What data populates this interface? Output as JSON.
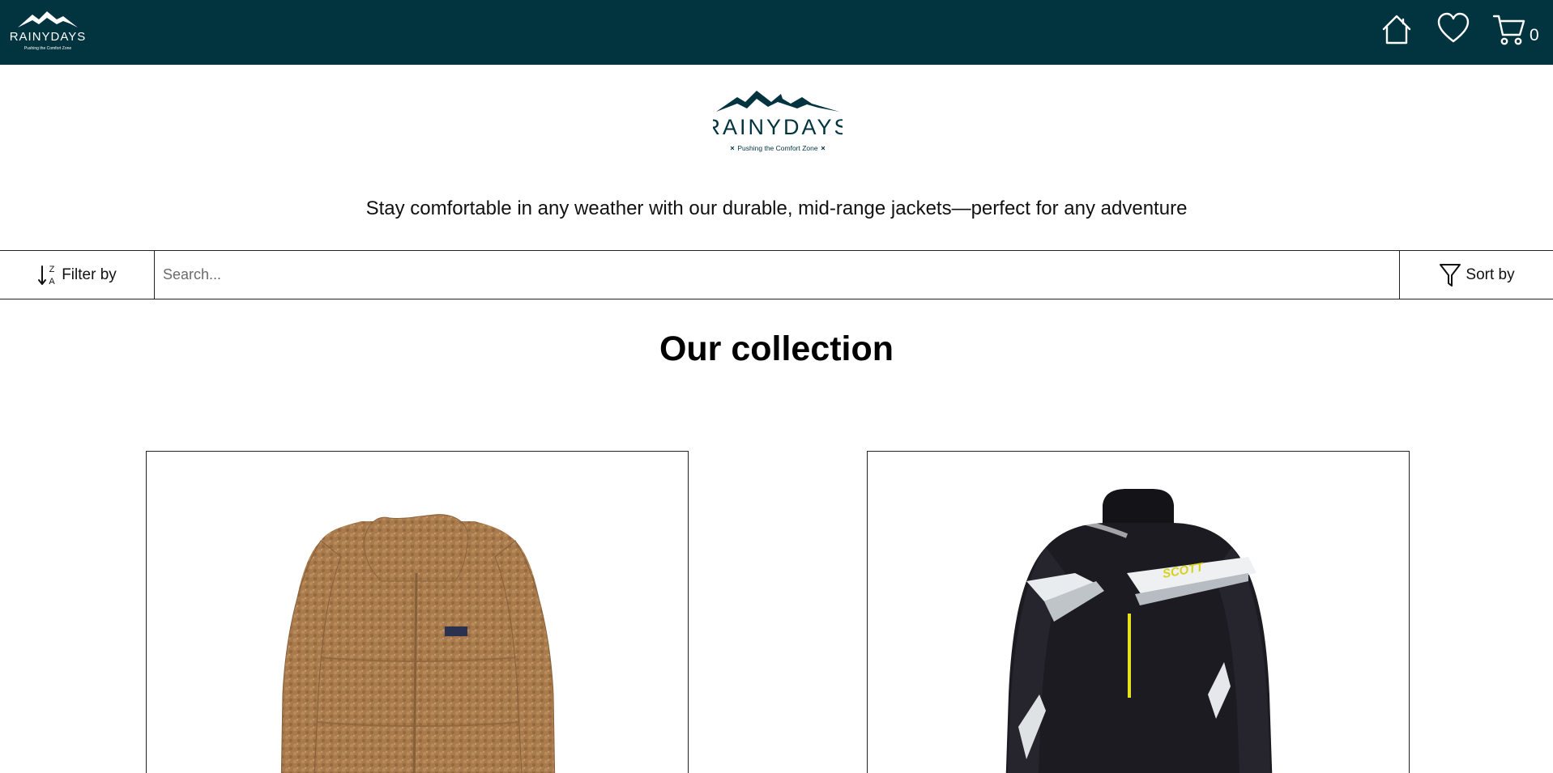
{
  "header": {
    "logo_text": "RAINYDAYS",
    "logo_slogan": "Pushing the Comfort Zone",
    "cart_count": "0",
    "icons": [
      "home-icon",
      "heart-icon",
      "cart-icon"
    ],
    "background_color": "#023440"
  },
  "brand": {
    "logo_text": "RAINYDAYS",
    "logo_slogan": "Pushing the Comfort Zone",
    "tagline": "Stay comfortable in any weather with our durable, mid-range jackets—perfect for any adventure"
  },
  "toolbar": {
    "filter_label": "Filter by",
    "filter_icon": "sort-alpha-icon",
    "search_placeholder": "Search...",
    "search_value": "",
    "sort_label": "Sort by",
    "sort_icon": "funnel-icon"
  },
  "main": {
    "title": "Our collection",
    "products": [
      {
        "image": "teddy-fleece-jacket-image",
        "color": "#a97a4c"
      },
      {
        "image": "black-scott-jacket-image",
        "brand_mark": "SCOTT",
        "color": "#1a1a1f"
      }
    ]
  }
}
